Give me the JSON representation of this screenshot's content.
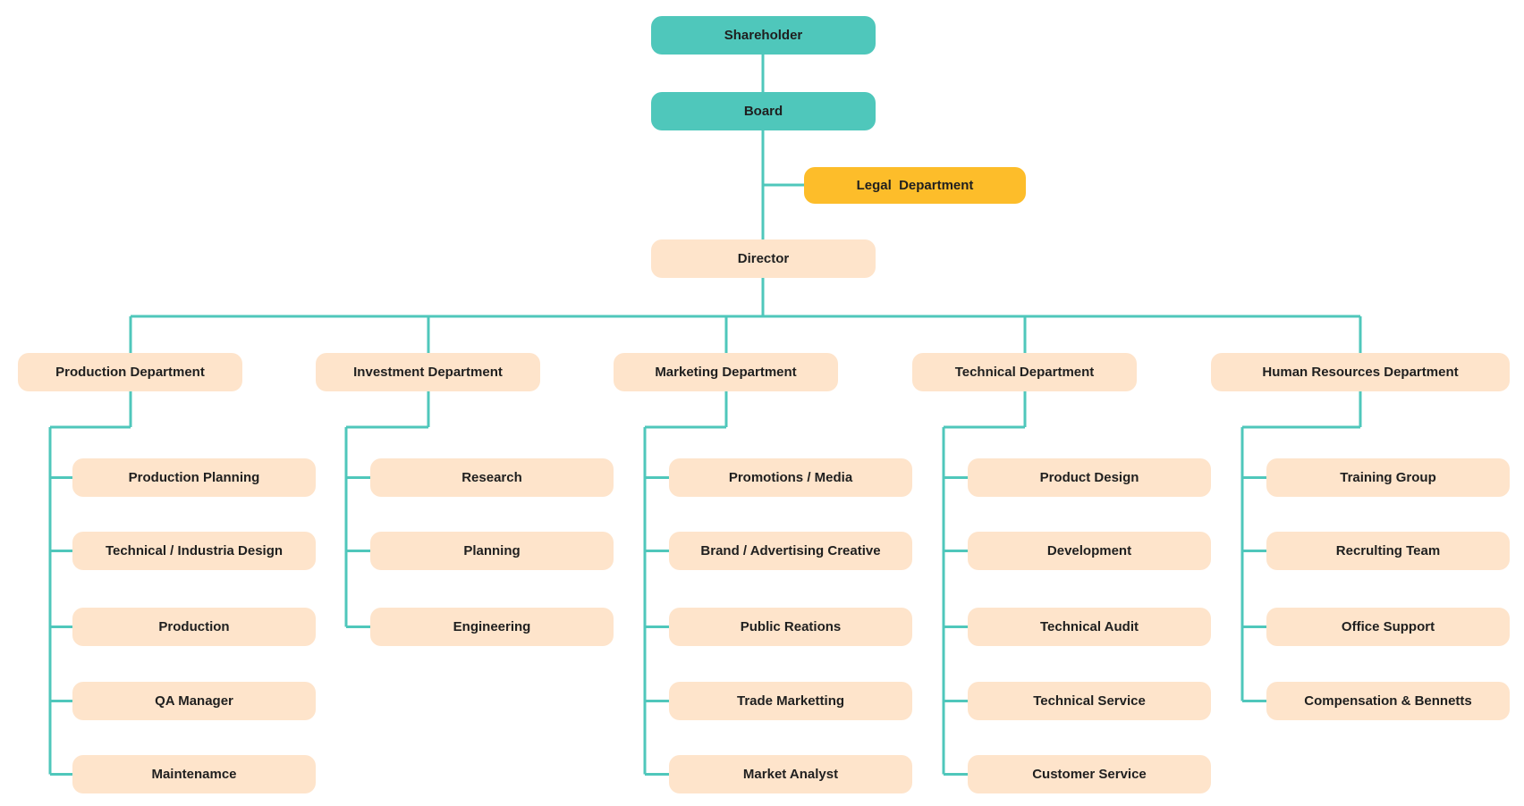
{
  "diagram": {
    "type": "org-chart",
    "colors": {
      "connector": "#4fc7bb",
      "top_node": "#4fc7bb",
      "legal_node": "#fdbd2a",
      "dept_node": "#fee4cb",
      "text": "#1f1f1f"
    },
    "top": {
      "shareholder": "Shareholder",
      "board": "Board",
      "legal": "Legal  Department",
      "director": "Director"
    },
    "departments": [
      {
        "name": "Production Department",
        "children": [
          "Production Planning",
          "Technical / Industria Design",
          "Production",
          "QA Manager",
          "Maintenamce"
        ]
      },
      {
        "name": "Investment Department",
        "children": [
          "Research",
          "Planning",
          "Engineering"
        ]
      },
      {
        "name": "Marketing Department",
        "children": [
          "Promotions / Media",
          "Brand / Advertising Creative",
          "Public Reations",
          "Trade Marketting",
          "Market Analyst"
        ]
      },
      {
        "name": "Technical Department",
        "children": [
          "Product Design",
          "Development",
          "Technical Audit",
          "Technical Service",
          "Customer Service"
        ]
      },
      {
        "name": "Human Resources Department",
        "children": [
          "Training Group",
          "Recrulting Team",
          "Office Support",
          "Compensation & Bennetts"
        ]
      }
    ]
  }
}
